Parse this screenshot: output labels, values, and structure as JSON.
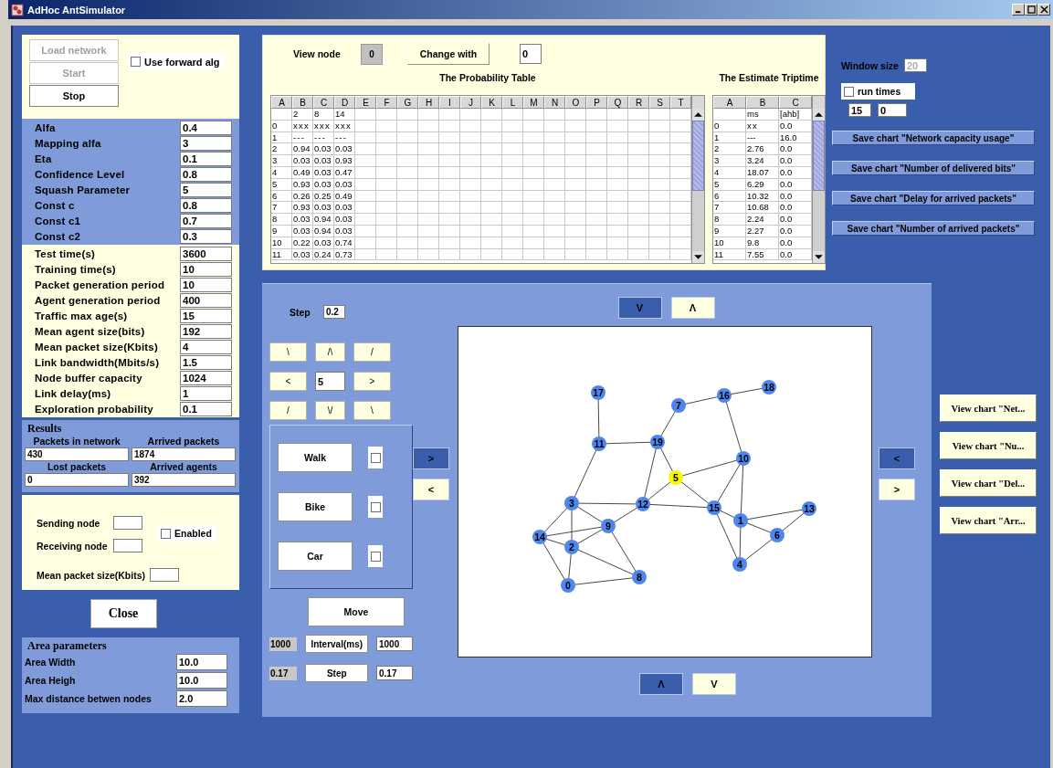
{
  "window": {
    "title": "AdHoc AntSimulator"
  },
  "controls": {
    "buttons": [
      {
        "label": "Load network",
        "disabled": true
      },
      {
        "label": "Start",
        "disabled": true
      },
      {
        "label": "Stop",
        "disabled": false
      }
    ],
    "forward_alg": {
      "label": "Use forward alg",
      "checked": false
    }
  },
  "algorithm_params": [
    {
      "label": "Alfa",
      "value": "0.4"
    },
    {
      "label": "Mapping alfa",
      "value": "3"
    },
    {
      "label": "Eta",
      "value": "0.1"
    },
    {
      "label": "Confidence Level",
      "value": "0.8"
    },
    {
      "label": "Squash Parameter",
      "value": "5"
    },
    {
      "label": "Const c",
      "value": "0.8"
    },
    {
      "label": "Const c1",
      "value": "0.7"
    },
    {
      "label": "Const c2",
      "value": "0.3"
    }
  ],
  "simulation_params": [
    {
      "label": "Test time(s)",
      "value": "3600"
    },
    {
      "label": "Training time(s)",
      "value": "10"
    },
    {
      "label": "Packet generation period",
      "value": "10"
    },
    {
      "label": "Agent generation period",
      "value": "400"
    },
    {
      "label": "Traffic max age(s)",
      "value": "15"
    },
    {
      "label": "Mean agent size(bits)",
      "value": "192"
    },
    {
      "label": "Mean packet size(Kbits)",
      "value": "4"
    },
    {
      "label": "Link bandwidth(Mbits/s)",
      "value": "1.5"
    },
    {
      "label": "Node buffer capacity",
      "value": "1024"
    },
    {
      "label": "Link delay(ms)",
      "value": "1"
    },
    {
      "label": "Exploration probability",
      "value": "0.1"
    }
  ],
  "results": {
    "title": "Results",
    "fields": [
      {
        "label": "Packets in network",
        "value": "430"
      },
      {
        "label": "Arrived packets",
        "value": "1874"
      },
      {
        "label": "Lost packets",
        "value": "0"
      },
      {
        "label": "Arrived agents",
        "value": "392"
      }
    ]
  },
  "traffic": {
    "sending_node": "Sending node",
    "receiving_node": "Receiving node",
    "enabled": {
      "label": "Enabled",
      "checked": false
    },
    "packet_size": "Mean packet size(Kbits)"
  },
  "close_button": "Close",
  "area": {
    "title": "Area parameters",
    "fields": [
      {
        "label": "Area Width",
        "value": "10.0"
      },
      {
        "label": "Area Heigh",
        "value": "10.0"
      },
      {
        "label": "Max distance betwen nodes",
        "value": "2.0"
      }
    ]
  },
  "node_view": {
    "label": "View node",
    "node": "0",
    "change_button": "Change with",
    "change_value": "0"
  },
  "probability_table": {
    "title": "The Probability Table",
    "columns": [
      "A",
      "B",
      "C",
      "D",
      "E",
      "F",
      "G",
      "H",
      "I",
      "J",
      "K",
      "L",
      "M",
      "N",
      "O",
      "P",
      "Q",
      "R",
      "S",
      "T"
    ],
    "destinations": [
      "2",
      "8",
      "14"
    ],
    "rows": [
      {
        "node": "0",
        "values": [
          "xxx",
          "xxx",
          "xxx"
        ]
      },
      {
        "node": "1",
        "values": [
          "---",
          "---",
          "---"
        ]
      },
      {
        "node": "2",
        "values": [
          "0.94",
          "0.03",
          "0.03"
        ]
      },
      {
        "node": "3",
        "values": [
          "0.03",
          "0.03",
          "0.93"
        ]
      },
      {
        "node": "4",
        "values": [
          "0.49",
          "0.03",
          "0.47"
        ]
      },
      {
        "node": "5",
        "values": [
          "0.93",
          "0.03",
          "0.03"
        ]
      },
      {
        "node": "6",
        "values": [
          "0.26",
          "0.25",
          "0.49"
        ]
      },
      {
        "node": "7",
        "values": [
          "0.93",
          "0.03",
          "0.03"
        ]
      },
      {
        "node": "8",
        "values": [
          "0.03",
          "0.94",
          "0.03"
        ]
      },
      {
        "node": "9",
        "values": [
          "0.03",
          "0.94",
          "0.03"
        ]
      },
      {
        "node": "10",
        "values": [
          "0.22",
          "0.03",
          "0.74"
        ]
      },
      {
        "node": "11",
        "values": [
          "0.03",
          "0.24",
          "0.73"
        ]
      }
    ]
  },
  "triptime_table": {
    "title": "The Estimate Triptime",
    "columns": [
      "A",
      "B",
      "C"
    ],
    "units": [
      "ms",
      "[ahb]"
    ],
    "rows": [
      {
        "node": "0",
        "values": [
          "xx",
          "0.0"
        ]
      },
      {
        "node": "1",
        "values": [
          "---",
          "16.0"
        ]
      },
      {
        "node": "2",
        "values": [
          "2.76",
          "0.0"
        ]
      },
      {
        "node": "3",
        "values": [
          "3.24",
          "0.0"
        ]
      },
      {
        "node": "4",
        "values": [
          "18.07",
          "0.0"
        ]
      },
      {
        "node": "5",
        "values": [
          "6.29",
          "0.0"
        ]
      },
      {
        "node": "6",
        "values": [
          "10.32",
          "0.0"
        ]
      },
      {
        "node": "7",
        "values": [
          "10.68",
          "0.0"
        ]
      },
      {
        "node": "8",
        "values": [
          "2.24",
          "0.0"
        ]
      },
      {
        "node": "9",
        "values": [
          "2.27",
          "0.0"
        ]
      },
      {
        "node": "10",
        "values": [
          "9.8",
          "0.0"
        ]
      },
      {
        "node": "11",
        "values": [
          "7.55",
          "0.0"
        ]
      }
    ]
  },
  "window_size": {
    "label": "Window size",
    "value": "20",
    "disabled": true
  },
  "run_times": {
    "label": "run times",
    "checked": false,
    "values": [
      "15",
      "0"
    ]
  },
  "save_buttons": [
    "Save chart \"Network capacity usage\"",
    "Save chart \"Number of delivered bits\"",
    "Save chart \"Delay for arrived packets\"",
    "Save chart \"Number of arrived packets\""
  ],
  "movement": {
    "step": {
      "label": "Step",
      "value": "0.2"
    },
    "pad": [
      {
        "kind": "button",
        "label": "\\"
      },
      {
        "kind": "button",
        "label": "/\\"
      },
      {
        "kind": "button",
        "label": "/"
      },
      {
        "kind": "button",
        "label": "<"
      },
      {
        "kind": "field",
        "value": "5"
      },
      {
        "kind": "button",
        "label": ">"
      },
      {
        "kind": "button",
        "label": "/"
      },
      {
        "kind": "button",
        "label": "\\/"
      },
      {
        "kind": "button",
        "label": "\\"
      }
    ],
    "modes": [
      {
        "label": "Walk",
        "checked": false
      },
      {
        "label": "Bike",
        "checked": false
      },
      {
        "label": "Car",
        "checked": false
      }
    ],
    "move_button": "Move",
    "timing": [
      {
        "current": "1000",
        "button": "Interval(ms)",
        "value": "1000"
      },
      {
        "current": "0.17",
        "button": "Step",
        "value": "0.17"
      }
    ]
  },
  "scroll_buttons": {
    "left": [
      {
        "label": ">",
        "selected": true
      },
      {
        "label": "<",
        "selected": false
      }
    ],
    "top": [
      {
        "label": "V",
        "selected": true
      },
      {
        "label": "Λ",
        "selected": false
      }
    ],
    "bottom": [
      {
        "label": "Λ",
        "selected": true
      },
      {
        "label": "V",
        "selected": false
      }
    ],
    "right": [
      {
        "label": "<",
        "selected": true
      },
      {
        "label": ">",
        "selected": false
      }
    ]
  },
  "network": {
    "nodes": [
      {
        "label": "18",
        "selected": false
      },
      {
        "label": "17",
        "selected": false
      },
      {
        "label": "16",
        "selected": false
      },
      {
        "label": "7",
        "selected": false
      },
      {
        "label": "19",
        "selected": false
      },
      {
        "label": "11",
        "selected": false
      },
      {
        "label": "10",
        "selected": false
      },
      {
        "label": "5",
        "selected": true
      },
      {
        "label": "3",
        "selected": false
      },
      {
        "label": "12",
        "selected": false
      },
      {
        "label": "15",
        "selected": false
      },
      {
        "label": "13",
        "selected": false
      },
      {
        "label": "1",
        "selected": false
      },
      {
        "label": "9",
        "selected": false
      },
      {
        "label": "6",
        "selected": false
      },
      {
        "label": "14",
        "selected": false
      },
      {
        "label": "2",
        "selected": false
      },
      {
        "label": "4",
        "selected": false
      },
      {
        "label": "8",
        "selected": false
      },
      {
        "label": "0",
        "selected": false
      }
    ]
  },
  "view_buttons": [
    "View chart \"Net...",
    "View chart \"Nu...",
    "View chart \"Del...",
    "View chart \"Arr..."
  ]
}
